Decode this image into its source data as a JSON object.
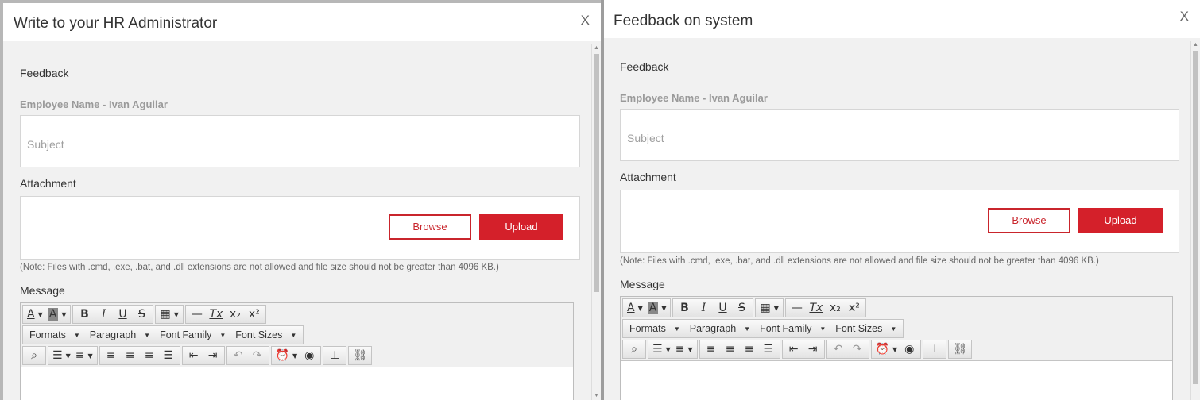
{
  "dialogs": [
    {
      "title": "Write to your HR Administrator",
      "close": "X",
      "feedback_label": "Feedback",
      "employee_label": "Employee Name - Ivan Aguilar",
      "subject_placeholder": "Subject",
      "attachment_label": "Attachment",
      "browse": "Browse",
      "upload": "Upload",
      "note": "(Note: Files with .cmd, .exe, .bat, and .dll extensions are not allowed and file size should not be greater than 4096 KB.)",
      "message_label": "Message"
    },
    {
      "title": "Feedback on system",
      "close": "X",
      "feedback_label": "Feedback",
      "employee_label": "Employee Name - Ivan Aguilar",
      "subject_placeholder": "Subject",
      "attachment_label": "Attachment",
      "browse": "Browse",
      "upload": "Upload",
      "note": "(Note: Files with .cmd, .exe, .bat, and .dll extensions are not allowed and file size should not be greater than 4096 KB.)",
      "message_label": "Message"
    }
  ],
  "toolbar": {
    "formats": "Formats",
    "paragraph": "Paragraph",
    "font_family": "Font Family",
    "font_sizes": "Font Sizes",
    "text_color_glyph": "A",
    "bg_color_glyph": "A",
    "bold": "B",
    "italic": "I",
    "underline": "U",
    "strike": "S",
    "subscript": "x₂",
    "superscript": "x²",
    "clear_format": "Tx"
  },
  "colors": {
    "accent": "#d4202a",
    "panel": "#f1f1f1"
  },
  "icons": [
    "close-icon",
    "text-color-icon",
    "bg-color-icon",
    "table-icon",
    "hr-icon",
    "clear-format-icon",
    "find-icon",
    "bullet-list-icon",
    "numbered-list-icon",
    "align-left-icon",
    "align-center-icon",
    "align-right-icon",
    "align-justify-icon",
    "outdent-icon",
    "indent-icon",
    "undo-icon",
    "redo-icon",
    "insert-time-icon",
    "preview-icon",
    "page-break-icon",
    "link-icon"
  ]
}
